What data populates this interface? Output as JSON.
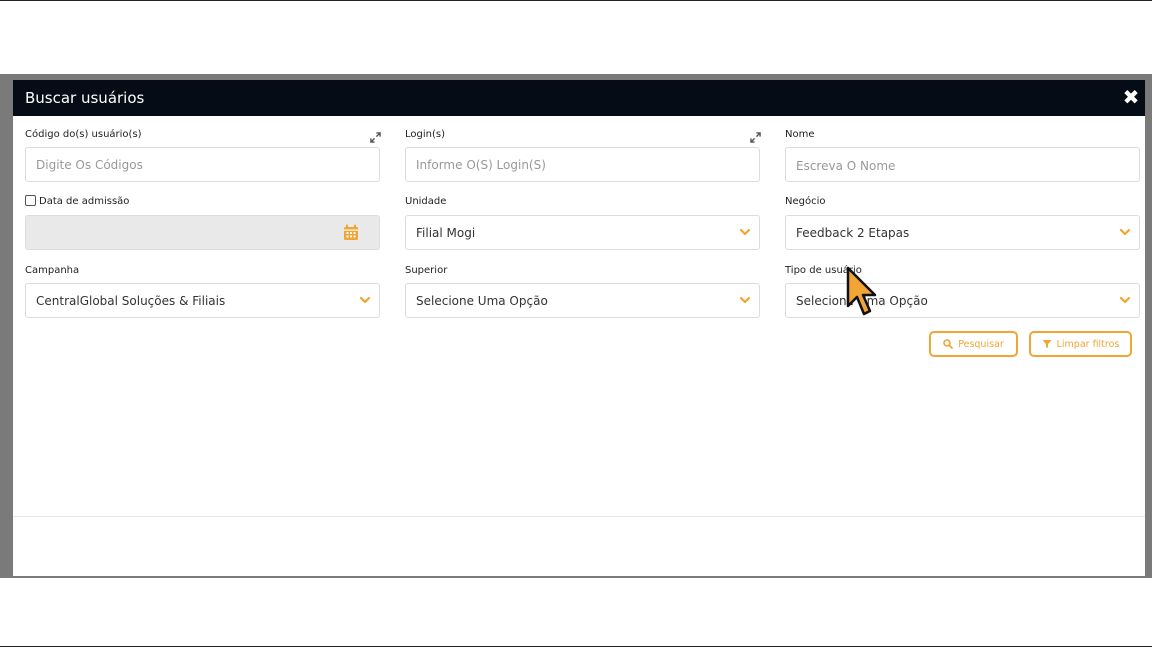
{
  "modal": {
    "title": "Buscar usuários",
    "close_label": "✖"
  },
  "fields": {
    "codigos": {
      "label": "Código do(s) usuário(s)",
      "placeholder": "Digite Os Códigos"
    },
    "login": {
      "label": "Login(s)",
      "placeholder": "Informe O(S) Login(S)"
    },
    "nome": {
      "label": "Nome",
      "placeholder": "Escreva O Nome"
    },
    "admissao": {
      "label": "Data de admissão",
      "checked": false
    },
    "unidade": {
      "label": "Unidade",
      "value": "Filial Mogi"
    },
    "negocio": {
      "label": "Negócio",
      "value": "Feedback 2 Etapas"
    },
    "campanha": {
      "label": "Campanha",
      "value": "CentralGlobal Soluções & Filiais"
    },
    "superior": {
      "label": "Superior",
      "value": "Selecione Uma Opção"
    },
    "tipo_usuario": {
      "label": "Tipo de usuário",
      "value": "Selecione Uma Opção"
    }
  },
  "buttons": {
    "pesquisar": "Pesquisar",
    "limpar": "Limpar filtros"
  },
  "colors": {
    "accent": "#f0a534",
    "header_bg": "#050c15",
    "border": "#d9dde3"
  },
  "icons": {
    "close": "close-icon",
    "expand": "expand-icon",
    "chevron": "chevron-down-icon",
    "calendar": "calendar-icon",
    "search": "search-icon",
    "filter": "filter-icon",
    "cursor": "mouse-pointer-icon"
  }
}
